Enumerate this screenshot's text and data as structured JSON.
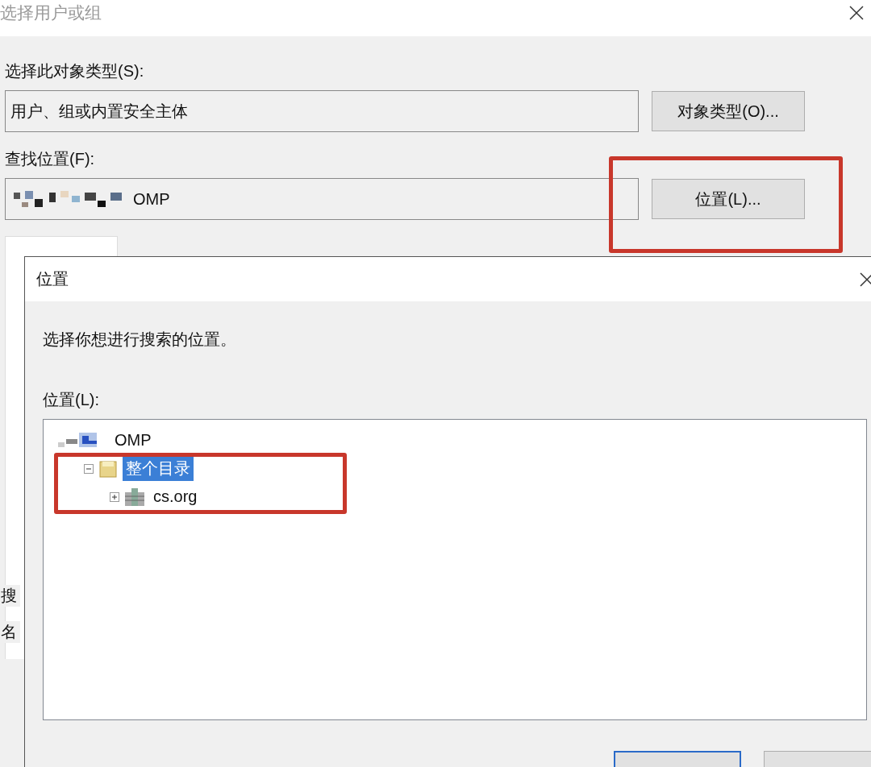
{
  "back_dialog": {
    "title": "选择用户或组",
    "object_type_label": "选择此对象类型(S):",
    "object_type_value": "用户、组或内置安全主体",
    "object_type_button": "对象类型(O)...",
    "location_label": "查找位置(F):",
    "location_value": "OMP",
    "location_button": "位置(L)...",
    "side_labels": [
      "搜",
      "名"
    ]
  },
  "location_dialog": {
    "title": "位置",
    "instruction": "选择你想进行搜索的位置。",
    "tree_label": "位置(L):",
    "tree": [
      {
        "label": "OMP",
        "kind": "computer",
        "selected": false,
        "children": [
          {
            "label": "整个目录",
            "kind": "folder",
            "expanded": true,
            "selected": true,
            "children": [
              {
                "label": "cs.org",
                "kind": "domain",
                "expanded": false,
                "selected": false
              }
            ]
          }
        ]
      }
    ],
    "buttons": [
      {
        "default": true
      },
      {
        "default": false
      }
    ]
  }
}
